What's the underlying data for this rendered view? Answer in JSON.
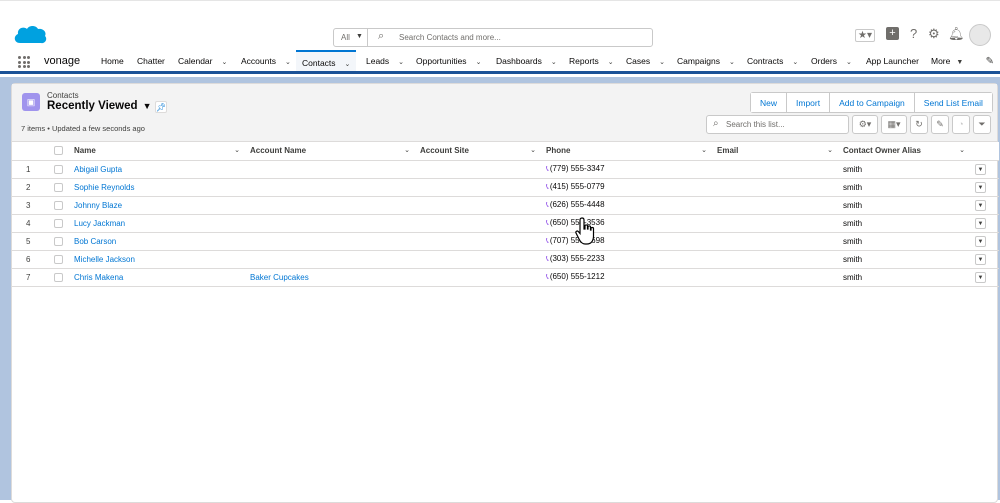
{
  "header": {
    "search_scope": "All",
    "search_placeholder": "Search Contacts and more...",
    "icons": [
      "favorites-icon",
      "add-icon",
      "help-icon",
      "setup-gear-icon",
      "notifications-bell-icon",
      "avatar"
    ]
  },
  "nav": {
    "app_name": "vonage",
    "items": [
      {
        "label": "Home",
        "dropdown": false
      },
      {
        "label": "Chatter",
        "dropdown": false
      },
      {
        "label": "Calendar",
        "dropdown": true
      },
      {
        "label": "Accounts",
        "dropdown": true
      },
      {
        "label": "Contacts",
        "dropdown": true,
        "active": true
      },
      {
        "label": "Leads",
        "dropdown": true
      },
      {
        "label": "Opportunities",
        "dropdown": true
      },
      {
        "label": "Dashboards",
        "dropdown": true
      },
      {
        "label": "Reports",
        "dropdown": true
      },
      {
        "label": "Cases",
        "dropdown": true
      },
      {
        "label": "Campaigns",
        "dropdown": true
      },
      {
        "label": "Contracts",
        "dropdown": true
      },
      {
        "label": "Orders",
        "dropdown": true
      },
      {
        "label": "App Launcher",
        "dropdown": false
      },
      {
        "label": "More",
        "dropdown": true
      }
    ]
  },
  "list": {
    "object_label": "Contacts",
    "list_name": "Recently Viewed",
    "meta": "7 items • Updated a few seconds ago",
    "buttons": [
      "New",
      "Import",
      "Add to Campaign",
      "Send List Email"
    ],
    "search_placeholder": "Search this list...",
    "columns": [
      "Name",
      "Account Name",
      "Account Site",
      "Phone",
      "Email",
      "Contact Owner Alias"
    ],
    "rows": [
      {
        "num": "1",
        "name": "Abigail Gupta",
        "account": "",
        "site": "",
        "phone": "(779) 555-3347",
        "email": "",
        "owner": "smith"
      },
      {
        "num": "2",
        "name": "Sophie Reynolds",
        "account": "",
        "site": "",
        "phone": "(415) 555-0779",
        "email": "",
        "owner": "smith"
      },
      {
        "num": "3",
        "name": "Johnny Blaze",
        "account": "",
        "site": "",
        "phone": "(626) 555-4448",
        "email": "",
        "owner": "smith"
      },
      {
        "num": "4",
        "name": "Lucy Jackman",
        "account": "",
        "site": "",
        "phone": "(650) 555-3536",
        "email": "",
        "owner": "smith"
      },
      {
        "num": "5",
        "name": "Bob Carson",
        "account": "",
        "site": "",
        "phone": "(707) 555-7698",
        "email": "",
        "owner": "smith"
      },
      {
        "num": "6",
        "name": "Michelle Jackson",
        "account": "",
        "site": "",
        "phone": "(303) 555-2233",
        "email": "",
        "owner": "smith"
      },
      {
        "num": "7",
        "name": "Chris Makena",
        "account": "Baker Cupcakes",
        "site": "",
        "phone": "(650) 555-1212",
        "email": "",
        "owner": "smith"
      }
    ]
  },
  "colors": {
    "brand": "#0176d3",
    "nav_underline": "#1b5297",
    "object_icon": "#a094ed",
    "phone_icon": "#9050e9"
  }
}
